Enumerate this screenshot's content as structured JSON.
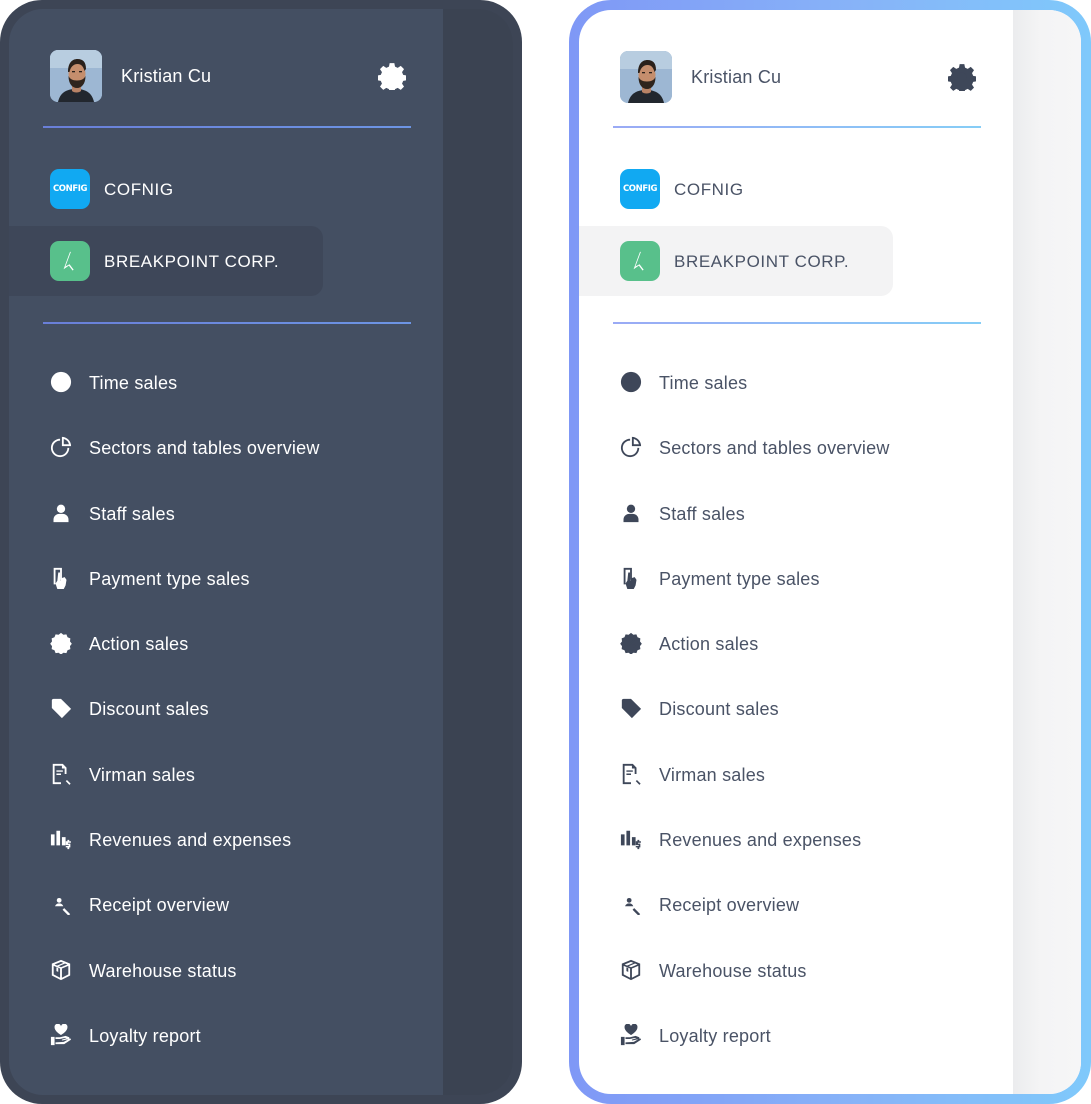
{
  "user": {
    "name": "Kristian Cu"
  },
  "companies": [
    {
      "name": "COFNIG",
      "logo_text": "CONFIG",
      "logo_color": "#11a9f2",
      "active": false
    },
    {
      "name": "BREAKPOINT CORP.",
      "logo_color": "#58c08b",
      "active": true
    }
  ],
  "menu": [
    {
      "label": "Time sales",
      "icon": "clock-icon"
    },
    {
      "label": "Sectors and tables overview",
      "icon": "pie-chart-icon"
    },
    {
      "label": "Staff sales",
      "icon": "person-icon"
    },
    {
      "label": "Payment type sales",
      "icon": "hand-card-icon"
    },
    {
      "label": "Action sales",
      "icon": "percent-badge-icon"
    },
    {
      "label": "Discount sales",
      "icon": "price-tag-icon"
    },
    {
      "label": "Virman sales",
      "icon": "document-search-icon"
    },
    {
      "label": "Revenues and expenses",
      "icon": "bar-chart-dollar-icon"
    },
    {
      "label": "Receipt overview",
      "icon": "magnifier-user-icon"
    },
    {
      "label": "Warehouse status",
      "icon": "box-icon"
    },
    {
      "label": "Loyalty report",
      "icon": "hand-heart-icon"
    }
  ],
  "themes": {
    "dark": {
      "background": "#444f62",
      "text": "#ffffff"
    },
    "light": {
      "background": "#ffffff",
      "text": "#4a5366",
      "border_gradient": [
        "#7f98f6",
        "#7fc9fb"
      ]
    }
  }
}
